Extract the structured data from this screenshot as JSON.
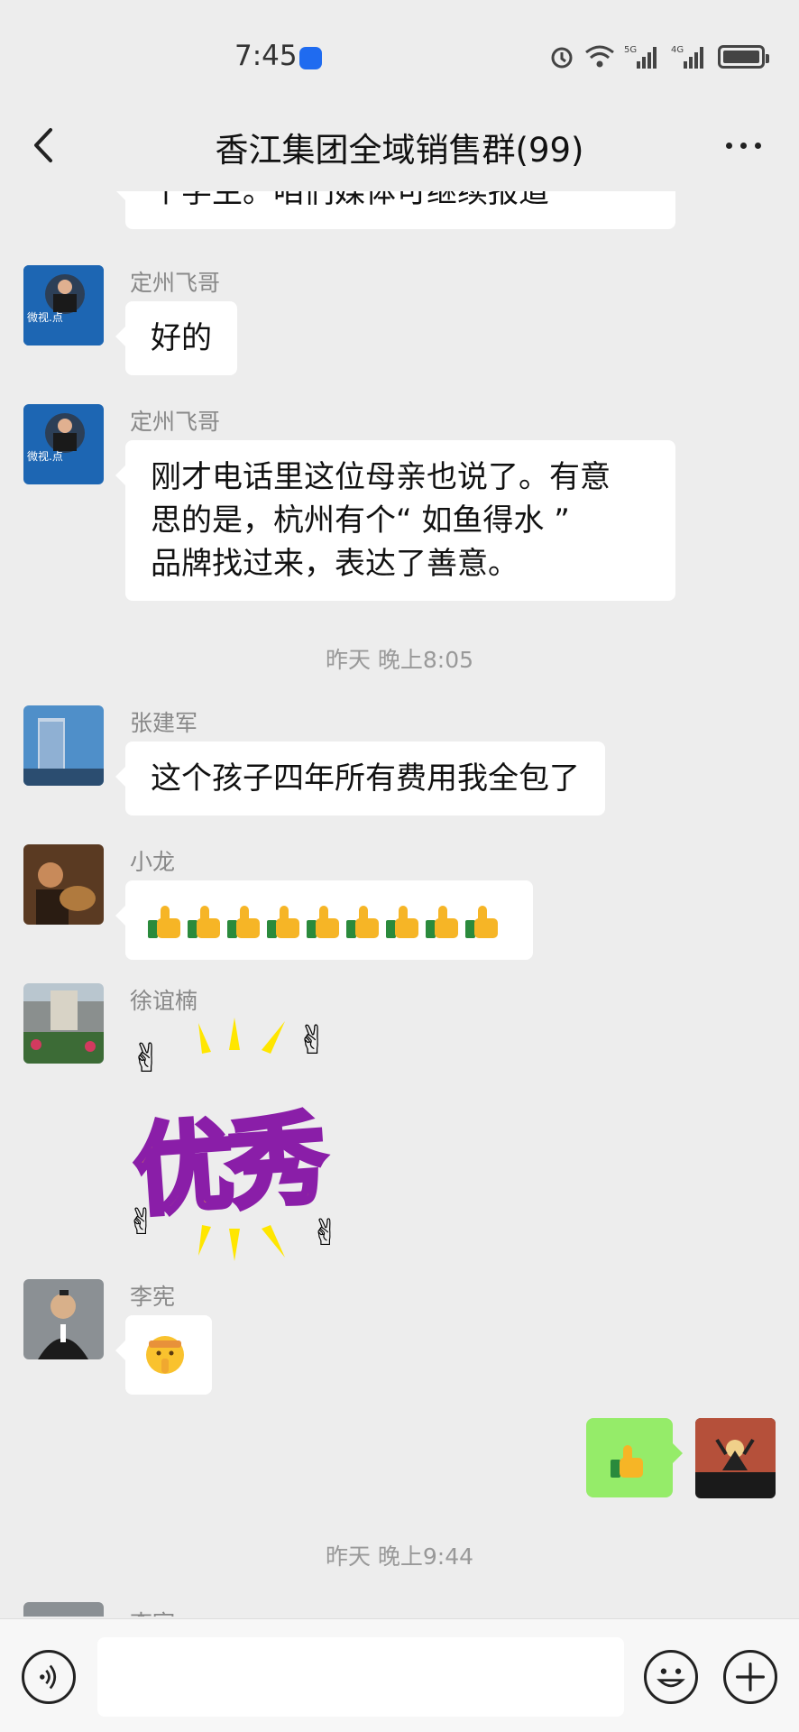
{
  "status": {
    "time": "7:45",
    "net5g": "5G",
    "net4g": "4G"
  },
  "header": {
    "title": "香江集团全域销售群(99)"
  },
  "messages": [
    {
      "sender": "",
      "text": "个学生。咱们媒体可继续报道"
    },
    {
      "sender": "定州飞哥",
      "text": "好的",
      "avatar_text": "微视.点"
    },
    {
      "sender": "定州飞哥",
      "lines": [
        "刚才电话里这位母亲也说了。有意",
        "思的是，杭州有个“ 如鱼得水 ”",
        "品牌找过来，表达了善意。"
      ],
      "avatar_text": "微视.点"
    },
    {
      "timestamp": "昨天 晚上8:05"
    },
    {
      "sender": "张建军",
      "text": "这个孩子四年所有费用我全包了"
    },
    {
      "sender": "小龙",
      "emoji": "thumbs-up",
      "emoji_count": 9
    },
    {
      "sender": "徐谊楠",
      "sticker_text": "优秀"
    },
    {
      "sender": "李宪",
      "emoji": "shush-face"
    },
    {
      "sender": "me",
      "emoji": "thumbs-up"
    },
    {
      "timestamp": "昨天 晚上9:44"
    },
    {
      "sender": "李宪",
      "partial": true
    }
  ],
  "colors": {
    "background": "#ededed",
    "bubble_in": "#ffffff",
    "bubble_out": "#95ec69",
    "accent_blue": "#1f6bf0"
  }
}
